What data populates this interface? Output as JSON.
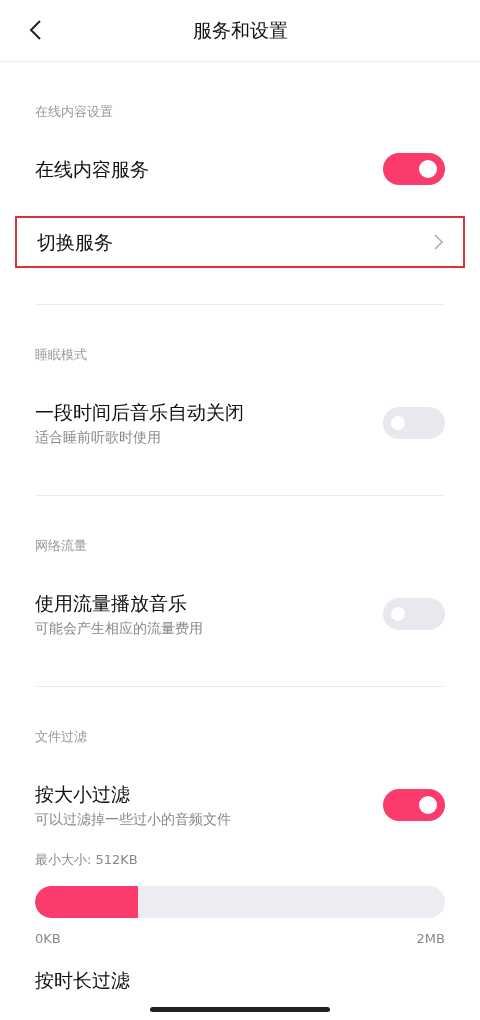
{
  "header": {
    "title": "服务和设置"
  },
  "sections": [
    {
      "title": "在线内容设置",
      "items": [
        {
          "kind": "toggle",
          "label": "在线内容服务",
          "on": true
        },
        {
          "kind": "link",
          "label": "切换服务",
          "highlighted": true
        }
      ]
    },
    {
      "title": "睡眠模式",
      "items": [
        {
          "kind": "toggle",
          "label": "一段时间后音乐自动关闭",
          "sublabel": "适合睡前听歌时使用",
          "on": false
        }
      ]
    },
    {
      "title": "网络流量",
      "items": [
        {
          "kind": "toggle",
          "label": "使用流量播放音乐",
          "sublabel": "可能会产生相应的流量费用",
          "on": false
        }
      ]
    },
    {
      "title": "文件过滤",
      "items": [
        {
          "kind": "toggle",
          "label": "按大小过滤",
          "sublabel": "可以过滤掉一些过小的音频文件",
          "on": true
        },
        {
          "kind": "slider",
          "label": "最小大小: 512KB",
          "level": 0.25,
          "min_label": "0KB",
          "max_label": "2MB"
        },
        {
          "kind": "plain",
          "label": "按时长过滤"
        }
      ]
    }
  ]
}
